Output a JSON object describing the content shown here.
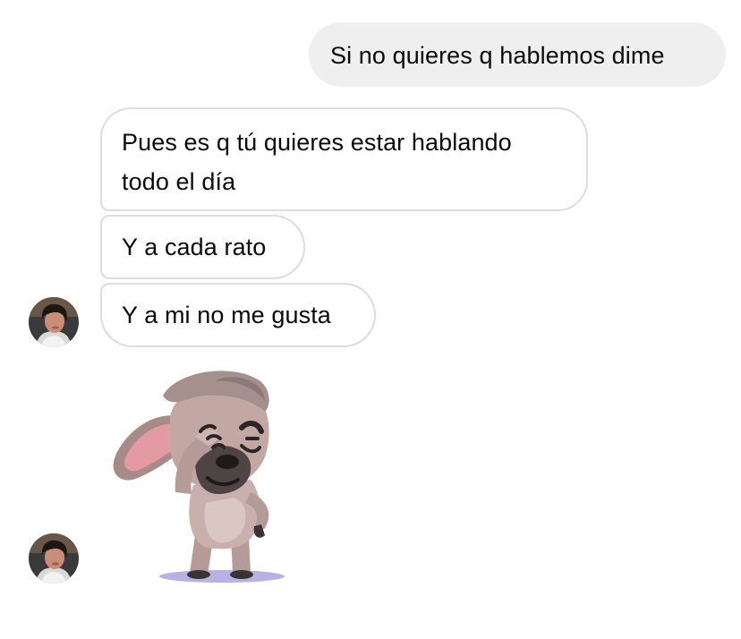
{
  "messages": [
    {
      "direction": "outgoing",
      "text": "Si no quieres q hablemos dime"
    },
    {
      "direction": "incoming",
      "lines": [
        "Pues es q tú quieres estar hablando",
        "todo el día"
      ]
    },
    {
      "direction": "incoming",
      "text": "Y a cada rato"
    },
    {
      "direction": "incoming",
      "text": "Y a mi no me gusta"
    },
    {
      "direction": "incoming",
      "type": "sticker",
      "sticker_icon": "facepalm-bulldog-sticker"
    }
  ],
  "colors": {
    "outgoing_bubble": "#efefef",
    "incoming_border": "#dcdcdc",
    "text": "#0a0a0a",
    "background": "#ffffff"
  }
}
